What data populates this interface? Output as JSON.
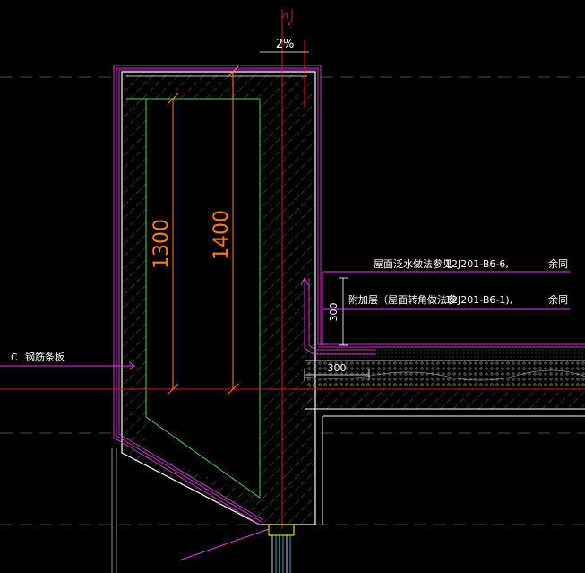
{
  "slope_label": "2%",
  "dimensions": {
    "inner_height": "1300",
    "outer_height": "1400",
    "flashing_height": "300",
    "flashing_width": "300"
  },
  "notes": {
    "line1": {
      "text": "屋面泛水做法参见",
      "ref": "12J201-B6-6,",
      "suffix": "余同"
    },
    "line2": {
      "text": "附加层（屋面转角做法参",
      "ref": "12J201-B6-1),",
      "suffix": "余同"
    },
    "left_label": {
      "prefix": "C",
      "text": "钢筋条板"
    }
  },
  "colors": {
    "background": "#000000",
    "wall_outline": "#ffffff",
    "hatch": "#8a8a8a",
    "waterproof": "#c040c0",
    "inner_green": "#50d050",
    "dimension": "#ff8020",
    "axis_red": "#d02020",
    "leader_magenta": "#e040e0",
    "text": "#ffffff"
  }
}
